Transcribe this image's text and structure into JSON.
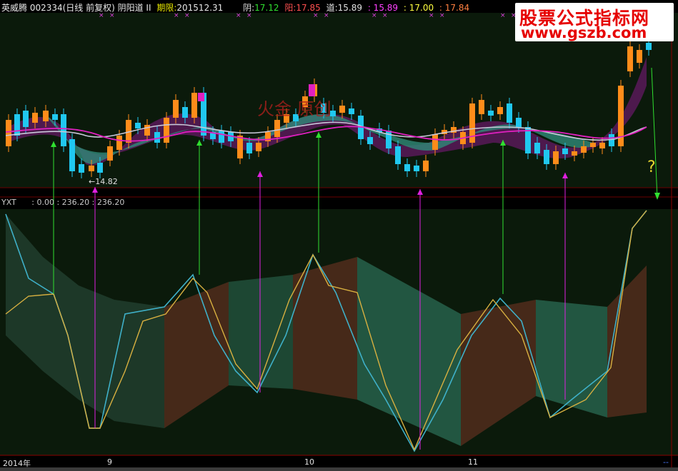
{
  "header": {
    "stock": "英威腾 002334(日线 前复权) 阴阳道 II",
    "period_label": "期限:",
    "period_value": "201512.31",
    "yin_label": "阴:",
    "yin_value": "17.12",
    "yang_label": "阳:",
    "yang_value": "17.85",
    "dao_label": "道:",
    "dao_value": "15.89",
    "v1": ": 15.89",
    "v2": ": 17.00",
    "v3": ": 17.84"
  },
  "watermark": {
    "line1": "股票公式指标网",
    "line2": "www.gszb.com"
  },
  "ghost_text": "火金 原创",
  "price_low_label": "←14.82",
  "question_mark": "?",
  "indicator": {
    "name": "YXT",
    "values": ": 0.00 : 236.20 : 236.20"
  },
  "xaxis": {
    "labels": [
      "2014年",
      "9",
      "10",
      "11",
      "--"
    ]
  },
  "colors": {
    "bull": "#ff8c1a",
    "bear": "#20c8f0",
    "up_arrow": "#30e030",
    "buy_arrow": "#e020e0",
    "teal_band": "#2f8a78",
    "purple_band": "#6a1a6a",
    "brown_fill": "#4a2a1a",
    "green_fill": "#1f4a36"
  },
  "chart_data": {
    "type": "candlestick-with-indicator",
    "price_low": 14.82,
    "indicator_value": 236.2
  }
}
